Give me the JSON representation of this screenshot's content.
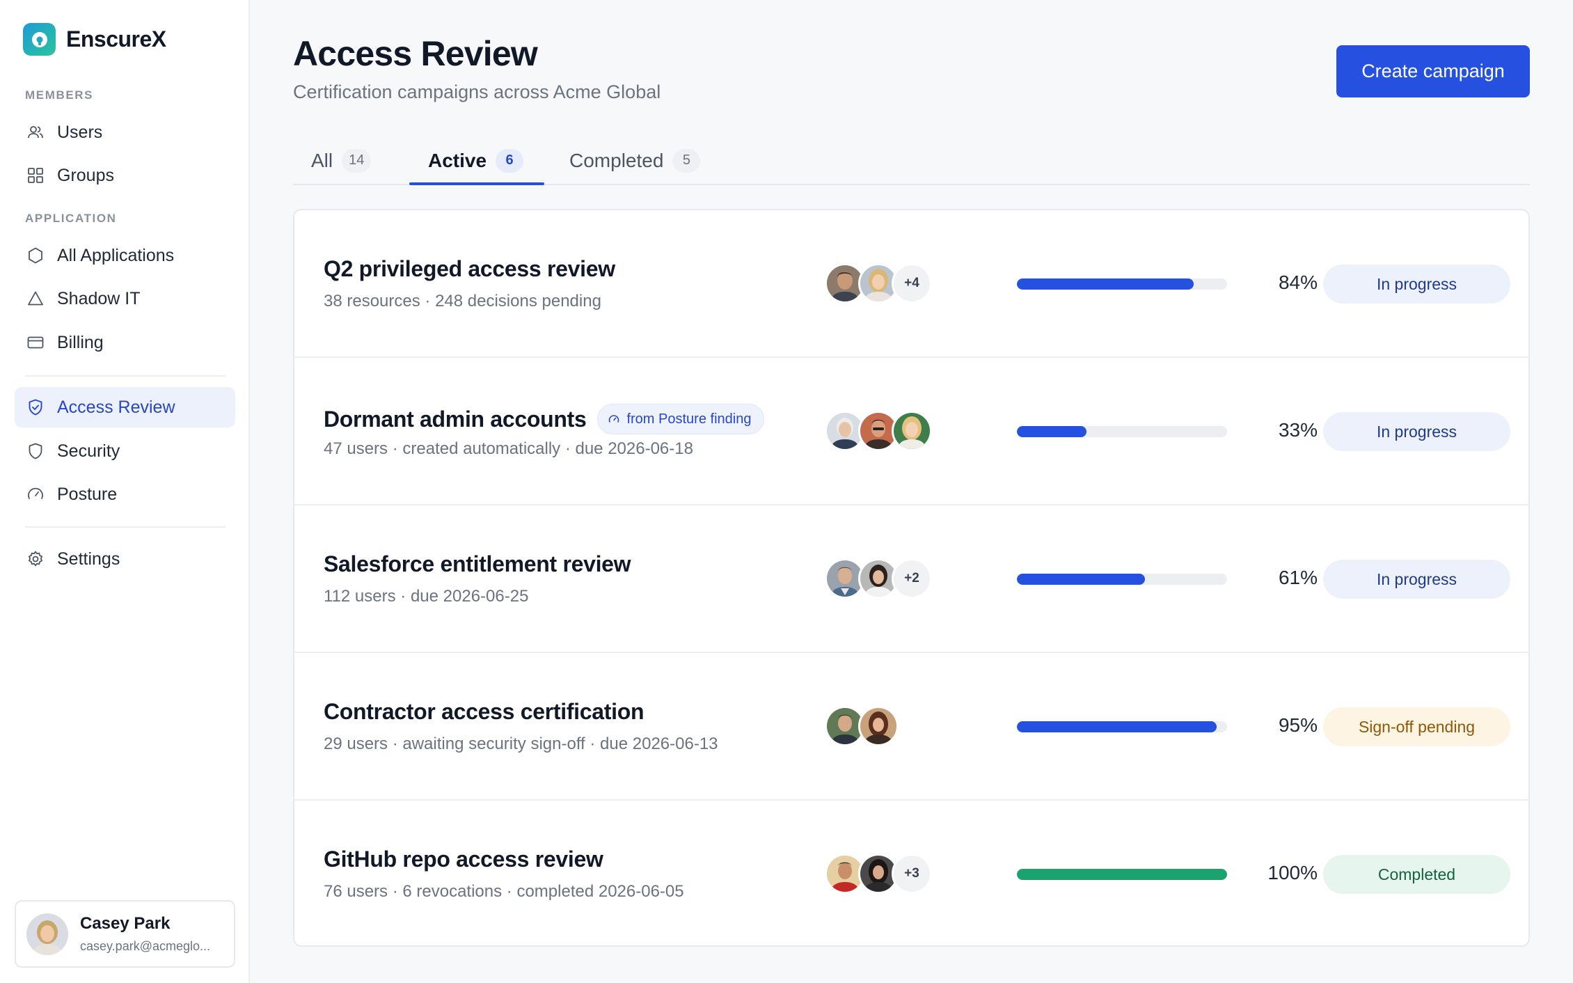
{
  "app": {
    "name": "EnscureX"
  },
  "sidebar": {
    "sections": [
      {
        "label": "MEMBERS"
      },
      {
        "label": "APPLICATION"
      }
    ],
    "items": [
      {
        "label": "Users",
        "icon": "users-icon"
      },
      {
        "label": "Groups",
        "icon": "grid-icon"
      },
      {
        "label": "All Applications",
        "icon": "hexagon-icon"
      },
      {
        "label": "Shadow IT",
        "icon": "triangle-icon"
      },
      {
        "label": "Billing",
        "icon": "credit-card-icon"
      },
      {
        "label": "Access Review",
        "icon": "shield-check-icon",
        "active": true
      },
      {
        "label": "Security",
        "icon": "shield-icon"
      },
      {
        "label": "Posture",
        "icon": "gauge-icon"
      },
      {
        "label": "Settings",
        "icon": "gear-icon"
      }
    ],
    "user": {
      "name": "Casey Park",
      "email": "casey.park@acmeglo..."
    }
  },
  "header": {
    "title": "Access Review",
    "subtitle": "Certification campaigns across Acme Global",
    "create_label": "Create campaign"
  },
  "tabs": [
    {
      "label": "All",
      "count": "14"
    },
    {
      "label": "Active",
      "count": "6",
      "active": true
    },
    {
      "label": "Completed",
      "count": "5"
    }
  ],
  "campaigns": [
    {
      "title": "Q2 privileged access review",
      "subtitle": "38 resources · 248 decisions pending",
      "tag": "",
      "avatars_shown": 2,
      "more": "+4",
      "progress": 84,
      "pct": "84%",
      "status": "In progress",
      "status_kind": "progress"
    },
    {
      "title": "Dormant admin accounts",
      "subtitle": "47 users · created automatically · due 2026-06-18",
      "tag": "from Posture finding",
      "avatars_shown": 3,
      "more": "",
      "progress": 33,
      "pct": "33%",
      "status": "In progress",
      "status_kind": "progress"
    },
    {
      "title": "Salesforce entitlement review",
      "subtitle": "112 users · due 2026-06-25",
      "tag": "",
      "avatars_shown": 2,
      "more": "+2",
      "progress": 61,
      "pct": "61%",
      "status": "In progress",
      "status_kind": "progress"
    },
    {
      "title": "Contractor access certification",
      "subtitle": "29 users · awaiting security sign-off · due 2026-06-13",
      "tag": "",
      "avatars_shown": 2,
      "more": "",
      "progress": 95,
      "pct": "95%",
      "status": "Sign-off pending",
      "status_kind": "pending"
    },
    {
      "title": "GitHub repo access review",
      "subtitle": "76 users · 6 revocations · completed 2026-06-05",
      "tag": "",
      "avatars_shown": 2,
      "more": "+3",
      "progress": 100,
      "pct": "100%",
      "status": "Completed",
      "status_kind": "done"
    }
  ],
  "colors": {
    "accent": "#2550e0",
    "progress_blue": "#2550e0",
    "progress_green": "#1aa36f",
    "status_progress_bg": "#edf1fc",
    "status_progress_fg": "#1e3a8a",
    "status_pending_bg": "#fdf4e3",
    "status_pending_fg": "#8a5a0a",
    "status_done_bg": "#e6f6ee",
    "status_done_fg": "#14633f"
  }
}
